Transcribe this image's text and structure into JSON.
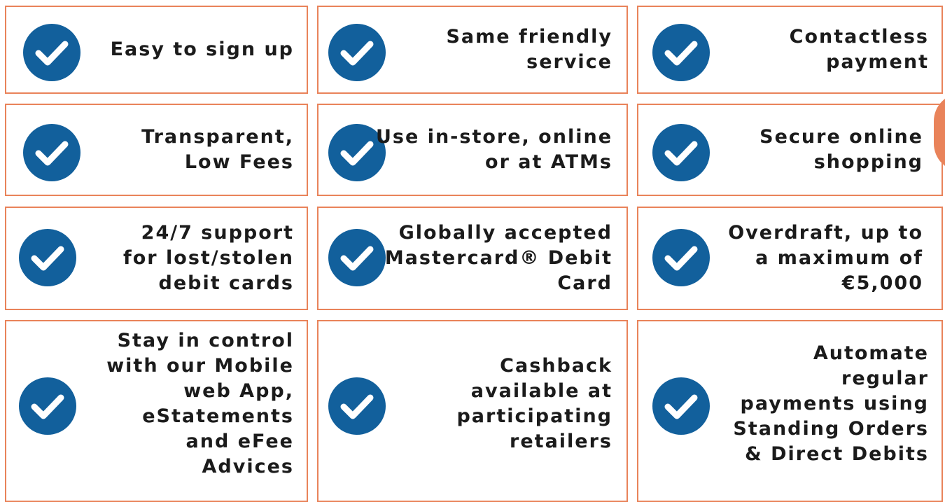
{
  "colors": {
    "border": "#e9835a",
    "check_circle": "#12609c",
    "check_mark": "#ffffff",
    "text": "#1b1b1b",
    "accent_tab": "#e9835a"
  },
  "icon": "check-circle-icon",
  "features": [
    [
      "Easy to sign up",
      "Same friendly\nservice",
      "Contactless\npayment"
    ],
    [
      "Transparent,\nLow Fees",
      "Use in-store, online\nor at ATMs",
      "Secure online\nshopping"
    ],
    [
      "24/7 support\nfor lost/stolen\ndebit cards",
      "Globally accepted\nMastercard® Debit\nCard",
      "Overdraft, up to\na maximum of\n€5,000"
    ],
    [
      "Stay in control\nwith our Mobile\nweb App,\neStatements\nand eFee\nAdvices",
      "Cashback\navailable at\nparticipating\nretailers",
      "Automate\nregular\npayments using\nStanding Orders\n& Direct Debits"
    ]
  ]
}
